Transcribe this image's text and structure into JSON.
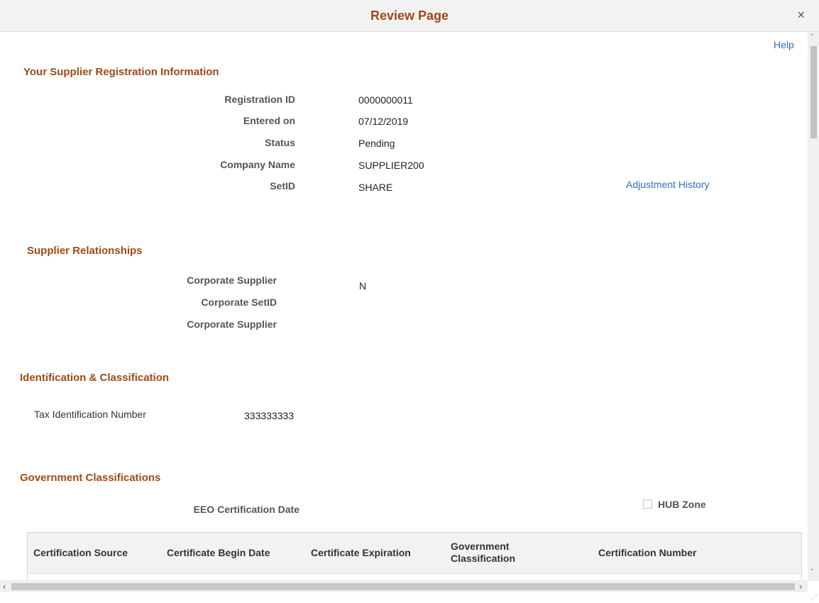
{
  "window": {
    "title": "Review Page",
    "close_glyph": "×"
  },
  "help_link": "Help",
  "registration": {
    "heading": "Your Supplier Registration Information",
    "fields": [
      {
        "label": "Registration ID",
        "value": "0000000011"
      },
      {
        "label": "Entered on",
        "value": "07/12/2019"
      },
      {
        "label": "Status",
        "value": "Pending"
      },
      {
        "label": "Company Name",
        "value": "SUPPLIER200"
      },
      {
        "label": "SetID",
        "value": "SHARE"
      }
    ],
    "adjustment_link": "Adjustment History"
  },
  "relationships": {
    "heading": "Supplier Relationships",
    "fields": [
      {
        "label": "Corporate Supplier",
        "value": "N"
      },
      {
        "label": "Corporate SetID",
        "value": ""
      },
      {
        "label": "Corporate Supplier",
        "value": ""
      }
    ]
  },
  "identification": {
    "heading": "Identification & Classification",
    "tax_label": "Tax Identification Number",
    "tax_value": "333333333"
  },
  "government": {
    "heading": "Government Classifications",
    "eeo_label": "EEO Certification Date",
    "hub_zone_label": "HUB Zone",
    "hub_zone_checked": false,
    "columns": [
      "Certification Source",
      "Certificate Begin Date",
      "Certificate Expiration",
      "Government Classification",
      "Certification Number"
    ]
  },
  "icons": {
    "close": "close-icon",
    "scroll_up": "chevron-up-icon",
    "scroll_down": "chevron-down-icon",
    "scroll_left": "chevron-left-icon",
    "scroll_right": "chevron-right-icon"
  },
  "colors": {
    "heading": "#9e4a17",
    "link": "#2e6ec9",
    "header_bg": "#f2f2f2"
  }
}
